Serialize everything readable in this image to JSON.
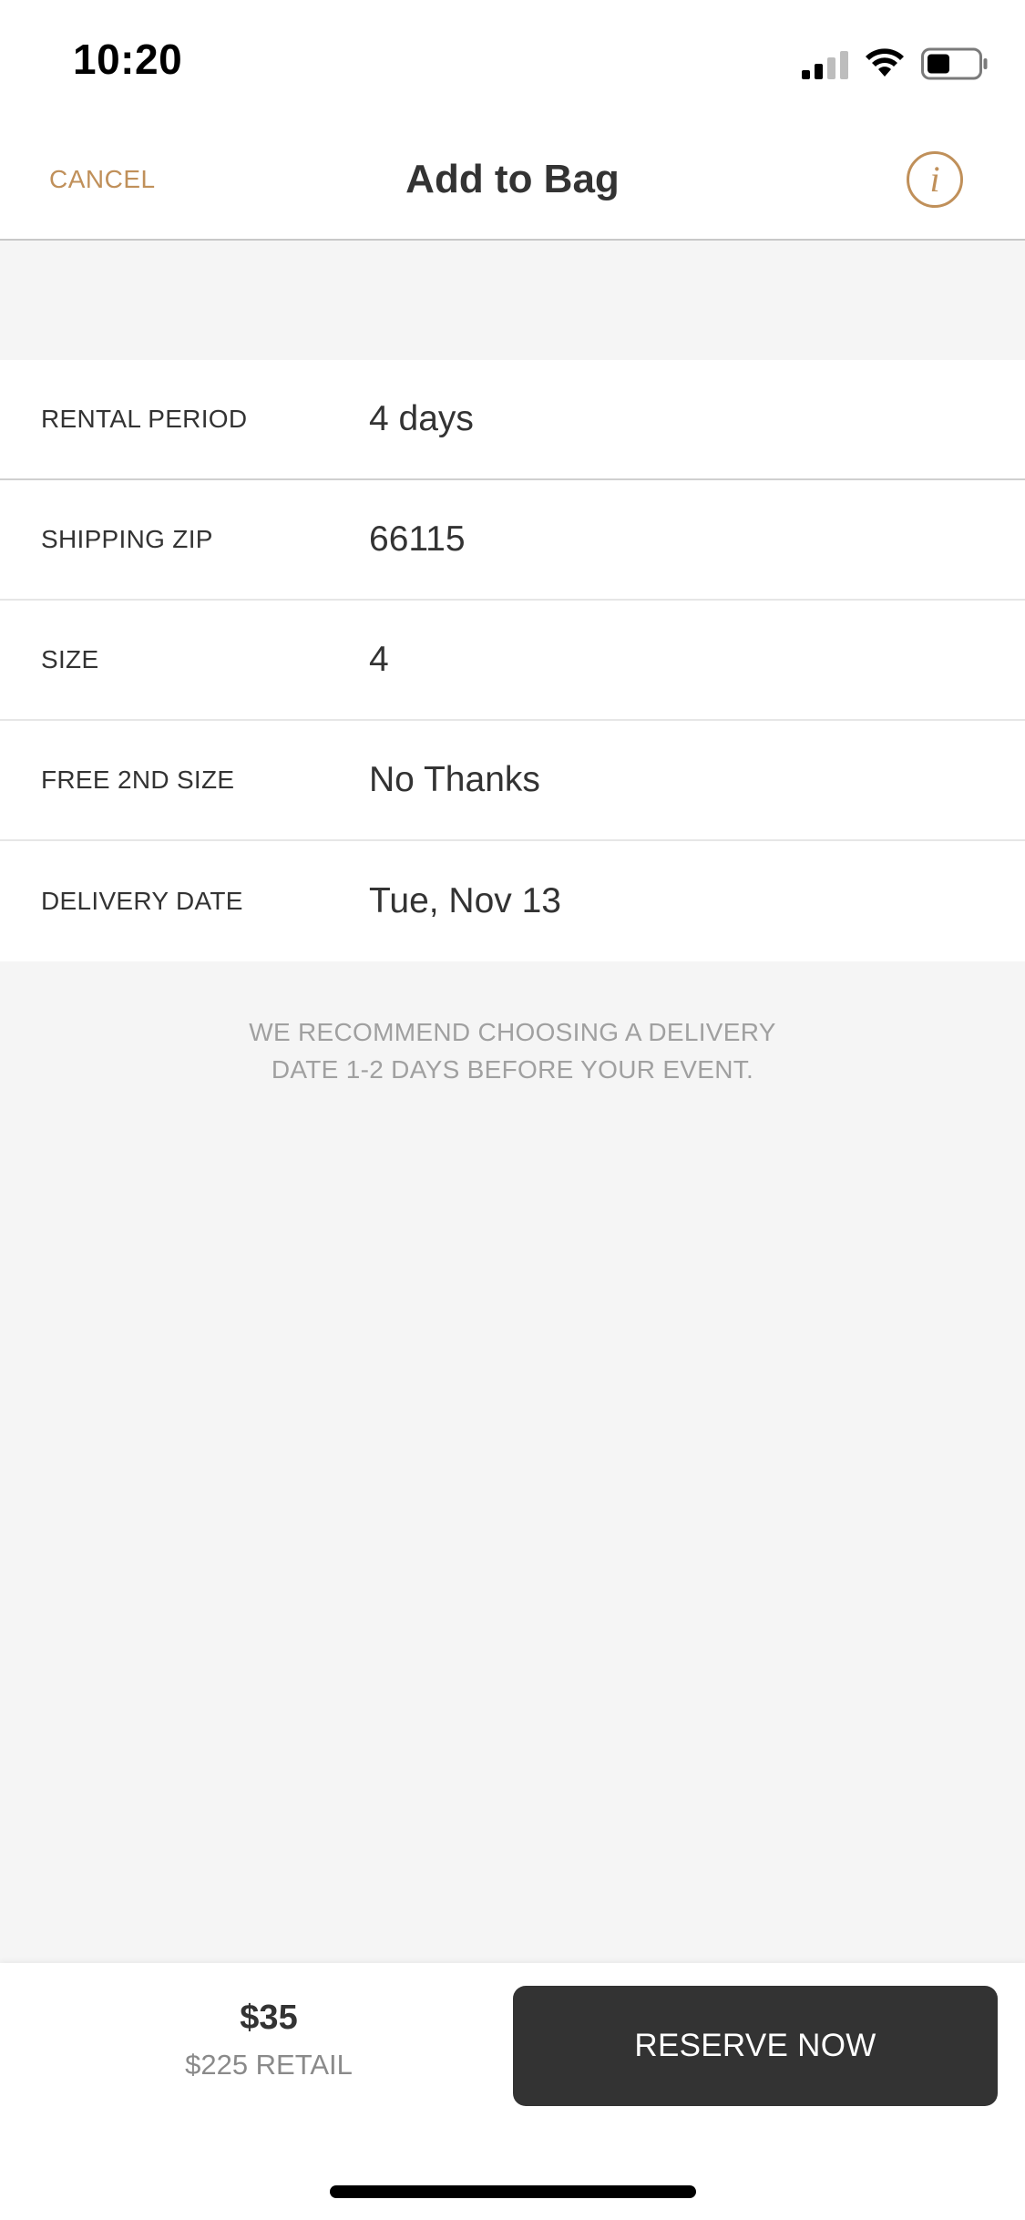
{
  "status_bar": {
    "time": "10:20",
    "icons": [
      "cellular-signal-icon",
      "wifi-icon",
      "battery-icon"
    ]
  },
  "header": {
    "cancel_label": "CANCEL",
    "title": "Add to Bag",
    "info_icon": "info-icon",
    "info_glyph": "i"
  },
  "form": {
    "rows": [
      {
        "label": "RENTAL PERIOD",
        "value": "4 days"
      },
      {
        "label": "SHIPPING ZIP",
        "value": "66115"
      },
      {
        "label": "SIZE",
        "value": "4"
      },
      {
        "label": "FREE 2ND SIZE",
        "value": "No Thanks"
      },
      {
        "label": "DELIVERY DATE",
        "value": "Tue, Nov 13"
      }
    ]
  },
  "note": {
    "line1": "WE RECOMMEND CHOOSING A DELIVERY",
    "line2": "DATE 1-2 DAYS BEFORE YOUR EVENT."
  },
  "footer": {
    "price": "$35",
    "retail": "$225 RETAIL",
    "reserve_label": "RESERVE NOW"
  },
  "colors": {
    "accent": "#c0905a",
    "button_bg": "#333333",
    "page_bg": "#f5f5f5"
  }
}
